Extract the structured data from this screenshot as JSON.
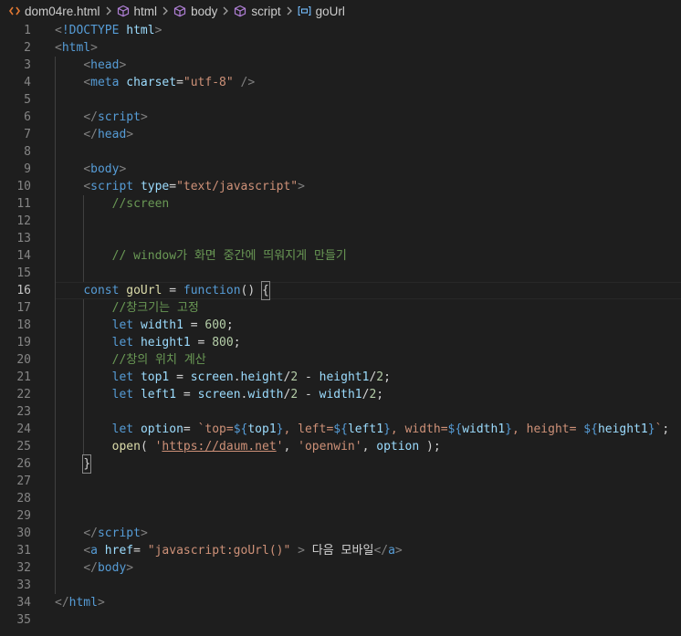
{
  "breadcrumb": {
    "file": "dom04re.html",
    "items": [
      "html",
      "body",
      "script",
      "goUrl"
    ]
  },
  "editor": {
    "current_line": 16,
    "lines": [
      {
        "n": "1",
        "tokens": [
          [
            "punct",
            "<"
          ],
          [
            "tag",
            "!DOCTYPE"
          ],
          [
            "plain",
            " "
          ],
          [
            "attr",
            "html"
          ],
          [
            "punct",
            ">"
          ]
        ]
      },
      {
        "n": "2",
        "tokens": [
          [
            "punct",
            "<"
          ],
          [
            "tag",
            "html"
          ],
          [
            "punct",
            ">"
          ]
        ]
      },
      {
        "n": "3",
        "tokens": [
          [
            "plain",
            "    "
          ],
          [
            "punct",
            "<"
          ],
          [
            "tag",
            "head"
          ],
          [
            "punct",
            ">"
          ]
        ]
      },
      {
        "n": "4",
        "tokens": [
          [
            "plain",
            "    "
          ],
          [
            "punct",
            "<"
          ],
          [
            "tag",
            "meta"
          ],
          [
            "plain",
            " "
          ],
          [
            "attr",
            "charset"
          ],
          [
            "plain",
            "="
          ],
          [
            "str",
            "\"utf-8\""
          ],
          [
            "plain",
            " "
          ],
          [
            "punct",
            "/>"
          ]
        ]
      },
      {
        "n": "5",
        "tokens": []
      },
      {
        "n": "6",
        "tokens": [
          [
            "plain",
            "    "
          ],
          [
            "punct",
            "</"
          ],
          [
            "tag",
            "script"
          ],
          [
            "punct",
            ">"
          ]
        ]
      },
      {
        "n": "7",
        "tokens": [
          [
            "plain",
            "    "
          ],
          [
            "punct",
            "</"
          ],
          [
            "tag",
            "head"
          ],
          [
            "punct",
            ">"
          ]
        ]
      },
      {
        "n": "8",
        "tokens": []
      },
      {
        "n": "9",
        "tokens": [
          [
            "plain",
            "    "
          ],
          [
            "punct",
            "<"
          ],
          [
            "tag",
            "body"
          ],
          [
            "punct",
            ">"
          ]
        ]
      },
      {
        "n": "10",
        "tokens": [
          [
            "plain",
            "    "
          ],
          [
            "punct",
            "<"
          ],
          [
            "tag",
            "script"
          ],
          [
            "plain",
            " "
          ],
          [
            "attr",
            "type"
          ],
          [
            "plain",
            "="
          ],
          [
            "str",
            "\"text/javascript\""
          ],
          [
            "punct",
            ">"
          ]
        ]
      },
      {
        "n": "11",
        "tokens": [
          [
            "plain",
            "        "
          ],
          [
            "com",
            "//screen"
          ]
        ]
      },
      {
        "n": "12",
        "tokens": []
      },
      {
        "n": "13",
        "tokens": []
      },
      {
        "n": "14",
        "tokens": [
          [
            "plain",
            "        "
          ],
          [
            "com",
            "// window가 화면 중간에 띄워지게 만들기"
          ]
        ]
      },
      {
        "n": "15",
        "tokens": []
      },
      {
        "n": "16",
        "tokens": [
          [
            "plain",
            "    "
          ],
          [
            "kw",
            "const"
          ],
          [
            "plain",
            " "
          ],
          [
            "fn",
            "goUrl"
          ],
          [
            "plain",
            " = "
          ],
          [
            "kw",
            "function"
          ],
          [
            "plain",
            "() "
          ],
          [
            "cursor",
            "{"
          ]
        ]
      },
      {
        "n": "17",
        "tokens": [
          [
            "plain",
            "        "
          ],
          [
            "com",
            "//창크기는 고정"
          ]
        ]
      },
      {
        "n": "18",
        "tokens": [
          [
            "plain",
            "        "
          ],
          [
            "kw",
            "let"
          ],
          [
            "plain",
            " "
          ],
          [
            "var",
            "width1"
          ],
          [
            "plain",
            " = "
          ],
          [
            "num",
            "600"
          ],
          [
            "plain",
            ";"
          ]
        ]
      },
      {
        "n": "19",
        "tokens": [
          [
            "plain",
            "        "
          ],
          [
            "kw",
            "let"
          ],
          [
            "plain",
            " "
          ],
          [
            "var",
            "height1"
          ],
          [
            "plain",
            " = "
          ],
          [
            "num",
            "800"
          ],
          [
            "plain",
            ";"
          ]
        ]
      },
      {
        "n": "20",
        "tokens": [
          [
            "plain",
            "        "
          ],
          [
            "com",
            "//창의 위치 계산"
          ]
        ]
      },
      {
        "n": "21",
        "tokens": [
          [
            "plain",
            "        "
          ],
          [
            "kw",
            "let"
          ],
          [
            "plain",
            " "
          ],
          [
            "var",
            "top1"
          ],
          [
            "plain",
            " = "
          ],
          [
            "var",
            "screen"
          ],
          [
            "plain",
            "."
          ],
          [
            "var",
            "height"
          ],
          [
            "plain",
            "/"
          ],
          [
            "num",
            "2"
          ],
          [
            "plain",
            " - "
          ],
          [
            "var",
            "height1"
          ],
          [
            "plain",
            "/"
          ],
          [
            "num",
            "2"
          ],
          [
            "plain",
            ";"
          ]
        ]
      },
      {
        "n": "22",
        "tokens": [
          [
            "plain",
            "        "
          ],
          [
            "kw",
            "let"
          ],
          [
            "plain",
            " "
          ],
          [
            "var",
            "left1"
          ],
          [
            "plain",
            " = "
          ],
          [
            "var",
            "screen"
          ],
          [
            "plain",
            "."
          ],
          [
            "var",
            "width"
          ],
          [
            "plain",
            "/"
          ],
          [
            "num",
            "2"
          ],
          [
            "plain",
            " - "
          ],
          [
            "var",
            "width1"
          ],
          [
            "plain",
            "/"
          ],
          [
            "num",
            "2"
          ],
          [
            "plain",
            ";"
          ]
        ]
      },
      {
        "n": "23",
        "tokens": []
      },
      {
        "n": "24",
        "tokens": [
          [
            "plain",
            "        "
          ],
          [
            "kw",
            "let"
          ],
          [
            "plain",
            " "
          ],
          [
            "var",
            "option"
          ],
          [
            "plain",
            "= "
          ],
          [
            "str",
            "`top="
          ],
          [
            "kw",
            "${"
          ],
          [
            "var",
            "top1"
          ],
          [
            "kw",
            "}"
          ],
          [
            "str",
            ", left="
          ],
          [
            "kw",
            "${"
          ],
          [
            "var",
            "left1"
          ],
          [
            "kw",
            "}"
          ],
          [
            "str",
            ", width="
          ],
          [
            "kw",
            "${"
          ],
          [
            "var",
            "width1"
          ],
          [
            "kw",
            "}"
          ],
          [
            "str",
            ", height= "
          ],
          [
            "kw",
            "${"
          ],
          [
            "var",
            "height1"
          ],
          [
            "kw",
            "}"
          ],
          [
            "str",
            "`"
          ],
          [
            "plain",
            ";"
          ]
        ]
      },
      {
        "n": "25",
        "tokens": [
          [
            "plain",
            "        "
          ],
          [
            "fn",
            "open"
          ],
          [
            "plain",
            "( "
          ],
          [
            "str",
            "'"
          ],
          [
            "link",
            "https://daum.net"
          ],
          [
            "str",
            "'"
          ],
          [
            "plain",
            ", "
          ],
          [
            "str",
            "'openwin'"
          ],
          [
            "plain",
            ", "
          ],
          [
            "var",
            "option"
          ],
          [
            "plain",
            " );"
          ]
        ]
      },
      {
        "n": "26",
        "tokens": [
          [
            "plain",
            "    "
          ],
          [
            "cursor",
            "}"
          ]
        ]
      },
      {
        "n": "27",
        "tokens": []
      },
      {
        "n": "28",
        "tokens": []
      },
      {
        "n": "29",
        "tokens": []
      },
      {
        "n": "30",
        "tokens": [
          [
            "plain",
            "    "
          ],
          [
            "punct",
            "</"
          ],
          [
            "tag",
            "script"
          ],
          [
            "punct",
            ">"
          ]
        ]
      },
      {
        "n": "31",
        "tokens": [
          [
            "plain",
            "    "
          ],
          [
            "punct",
            "<"
          ],
          [
            "tag",
            "a"
          ],
          [
            "plain",
            " "
          ],
          [
            "attr",
            "href"
          ],
          [
            "plain",
            "= "
          ],
          [
            "str",
            "\"javascript:goUrl()\""
          ],
          [
            "plain",
            " "
          ],
          [
            "punct",
            ">"
          ],
          [
            "text",
            " 다음 모바일"
          ],
          [
            "punct",
            "</"
          ],
          [
            "tag",
            "a"
          ],
          [
            "punct",
            ">"
          ]
        ]
      },
      {
        "n": "32",
        "tokens": [
          [
            "plain",
            "    "
          ],
          [
            "punct",
            "</"
          ],
          [
            "tag",
            "body"
          ],
          [
            "punct",
            ">"
          ]
        ]
      },
      {
        "n": "33",
        "tokens": []
      },
      {
        "n": "34",
        "tokens": [
          [
            "punct",
            "</"
          ],
          [
            "tag",
            "html"
          ],
          [
            "punct",
            ">"
          ]
        ]
      },
      {
        "n": "35",
        "tokens": []
      }
    ]
  }
}
